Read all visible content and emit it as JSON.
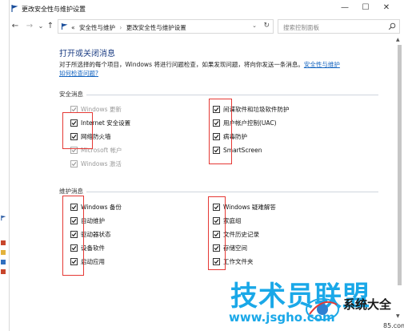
{
  "window": {
    "title": "更改安全性与维护设置",
    "controls": {
      "minimize": "—",
      "maximize": "☐",
      "close": "✕"
    }
  },
  "nav": {
    "back": "←",
    "forward": "→",
    "recent": "⌄",
    "up": "↑",
    "address_root": "«",
    "breadcrumb": [
      "安全性与维护",
      "更改安全性与维护设置"
    ],
    "separator": "›",
    "dropdown": "⌄",
    "refresh": "↻",
    "search_placeholder": "搜索控制面板"
  },
  "main": {
    "heading": "打开或关闭消息",
    "description": "对于所选择的每个项目，Windows 将进行问题检查，如果发现问题，将向你发送一条消息。",
    "description_link_1": "安全性与维护",
    "description_link_2": "如何检查问题?"
  },
  "security": {
    "title": "安全消息",
    "left": [
      {
        "label": "Windows 更新",
        "checked": true,
        "disabled": true
      },
      {
        "label": "Internet 安全设置",
        "checked": true,
        "disabled": false
      },
      {
        "label": "网络防火墙",
        "checked": true,
        "disabled": false
      },
      {
        "label": "Microsoft 帐户",
        "checked": true,
        "disabled": true
      },
      {
        "label": "Windows 激活",
        "checked": true,
        "disabled": true
      }
    ],
    "right": [
      {
        "label": "间谍软件和垃圾软件防护",
        "checked": true,
        "disabled": false
      },
      {
        "label": "用户帐户控制(UAC)",
        "checked": true,
        "disabled": false
      },
      {
        "label": "病毒防护",
        "checked": true,
        "disabled": false
      },
      {
        "label": "SmartScreen",
        "checked": true,
        "disabled": false
      }
    ]
  },
  "maintenance": {
    "title": "维护消息",
    "left": [
      {
        "label": "Windows 备份",
        "checked": true
      },
      {
        "label": "自动维护",
        "checked": true
      },
      {
        "label": "驱动器状态",
        "checked": true
      },
      {
        "label": "设备软件",
        "checked": true
      },
      {
        "label": "启动应用",
        "checked": true
      }
    ],
    "right": [
      {
        "label": "Windows 疑难解答",
        "checked": true
      },
      {
        "label": "家庭组",
        "checked": true
      },
      {
        "label": "文件历史记录",
        "checked": true
      },
      {
        "label": "存储空间",
        "checked": true
      },
      {
        "label": "工作文件夹",
        "checked": true
      }
    ]
  },
  "watermark": {
    "brand": "技术员联盟",
    "url": "www.jsgho.com",
    "tail": "系统大全",
    "tail_small": "85.com"
  },
  "scroll": {
    "up": "▲",
    "down": "▼"
  },
  "colors": {
    "heading": "#1e3f84",
    "link": "#1565c0",
    "highlight": "#e53935",
    "watermark": "#1aa8e8"
  }
}
